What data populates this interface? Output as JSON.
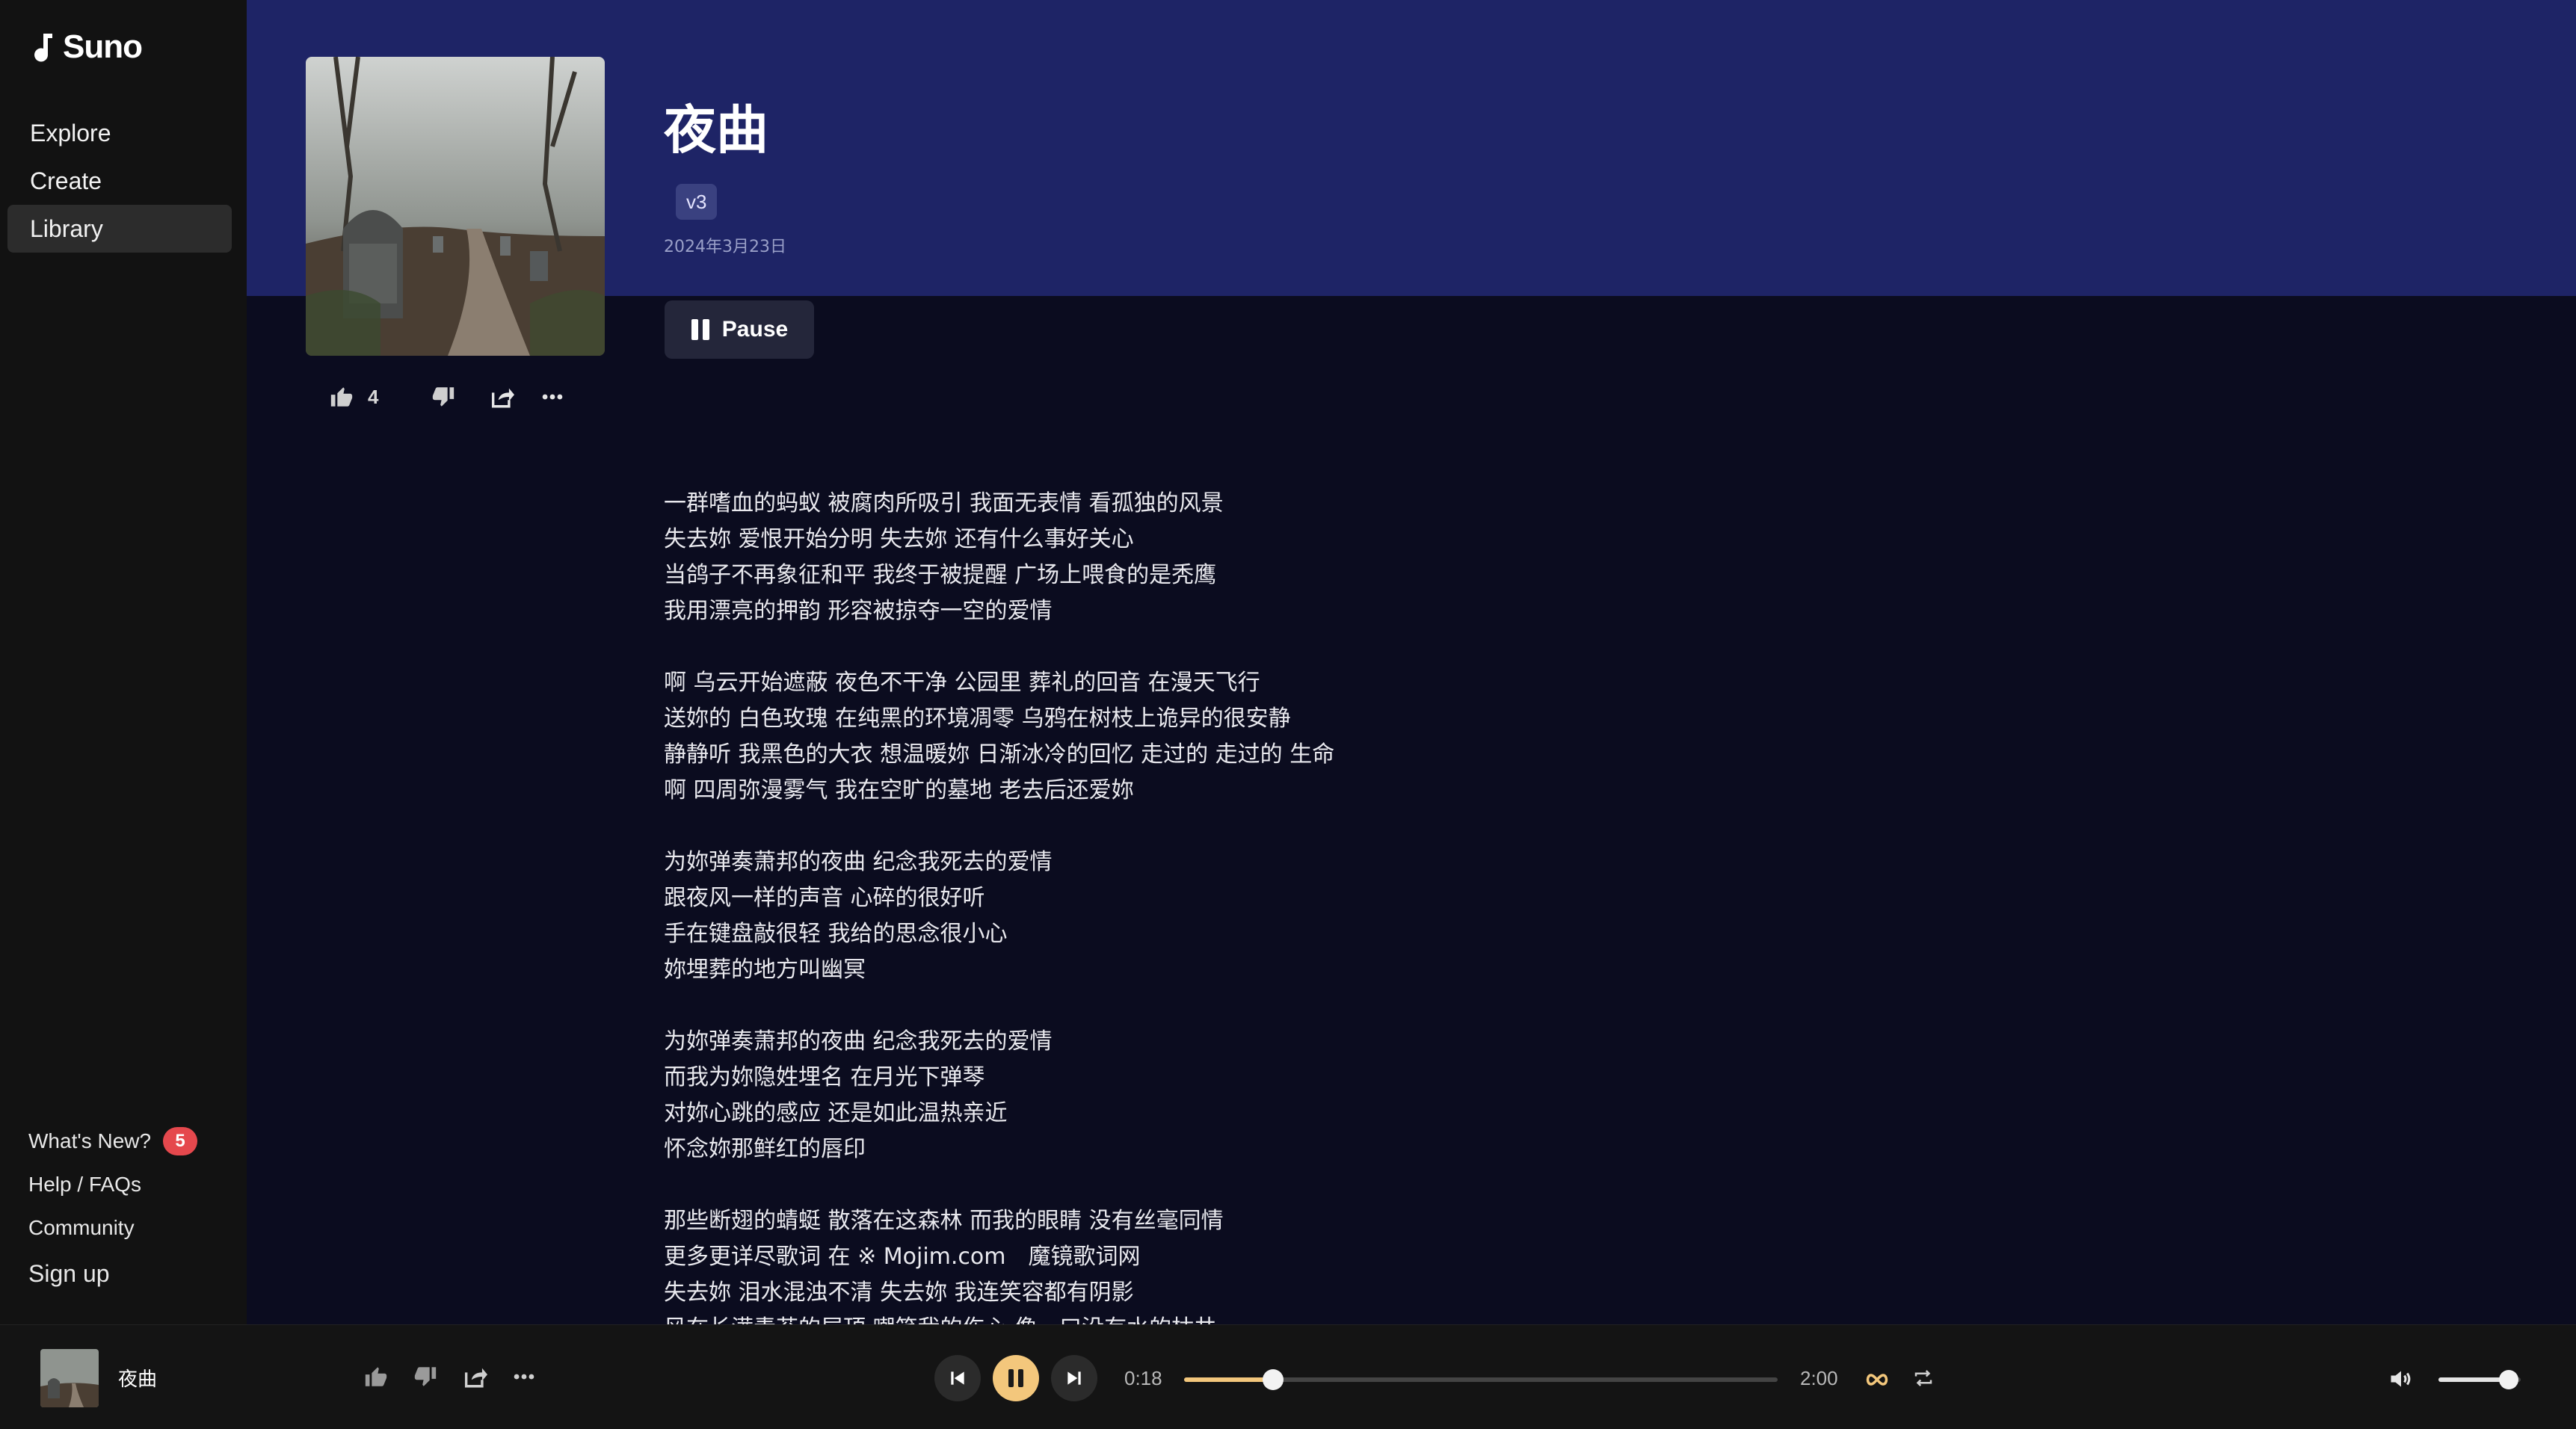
{
  "app": {
    "name": "Suno"
  },
  "sidebar": {
    "nav": [
      {
        "label": "Explore",
        "active": false
      },
      {
        "label": "Create",
        "active": false
      },
      {
        "label": "Library",
        "active": true
      }
    ],
    "footer": {
      "whats_new": "What's New?",
      "whats_new_count": "5",
      "help": "Help / FAQs",
      "community": "Community",
      "signup": "Sign up"
    }
  },
  "song": {
    "title": "夜曲",
    "version": "v3",
    "date": "2024年3月23日",
    "likes": "4",
    "pause_label": "Pause"
  },
  "lyrics": "一群嗜血的蚂蚁 被腐肉所吸引 我面无表情 看孤独的风景\n失去妳 爱恨开始分明 失去妳 还有什么事好关心\n当鸽子不再象征和平 我终于被提醒 广场上喂食的是秃鹰\n我用漂亮的押韵 形容被掠夺一空的爱情\n\n啊 乌云开始遮蔽 夜色不干净 公园里 葬礼的回音 在漫天飞行\n送妳的 白色玫瑰 在纯黑的环境凋零 乌鸦在树枝上诡异的很安静\n静静听 我黑色的大衣 想温暖妳 日渐冰冷的回忆 走过的 走过的 生命\n啊 四周弥漫雾气 我在空旷的墓地 老去后还爱妳\n\n为妳弹奏萧邦的夜曲 纪念我死去的爱情\n跟夜风一样的声音 心碎的很好听\n手在键盘敲很轻 我给的思念很小心\n妳埋葬的地方叫幽冥\n\n为妳弹奏萧邦的夜曲 纪念我死去的爱情\n而我为妳隐姓埋名 在月光下弹琴\n对妳心跳的感应 还是如此温热亲近\n怀念妳那鲜红的唇印\n\n那些断翅的蜻蜓 散落在这森林 而我的眼睛 没有丝毫同情\n更多更详尽歌词 在 ※ Mojim.com　魔镜歌词网\n失去妳 泪水混浊不清 失去妳 我连笑容都有阴影\n风在长满青苔的屋顶 嘲笑我的伤心 像一口没有水的枯井",
  "player": {
    "title": "夜曲",
    "elapsed": "0:18",
    "duration": "2:00",
    "progress": 0.15,
    "volume": 0.85
  },
  "colors": {
    "header": "#1e2466",
    "accent": "#f3c77c",
    "badge": "#e5484d"
  },
  "icons": [
    "thumbs-up-icon",
    "thumbs-down-icon",
    "share-icon",
    "more-icon",
    "prev-icon",
    "pause-icon",
    "next-icon",
    "loop-icon",
    "repeat-icon",
    "volume-icon"
  ]
}
